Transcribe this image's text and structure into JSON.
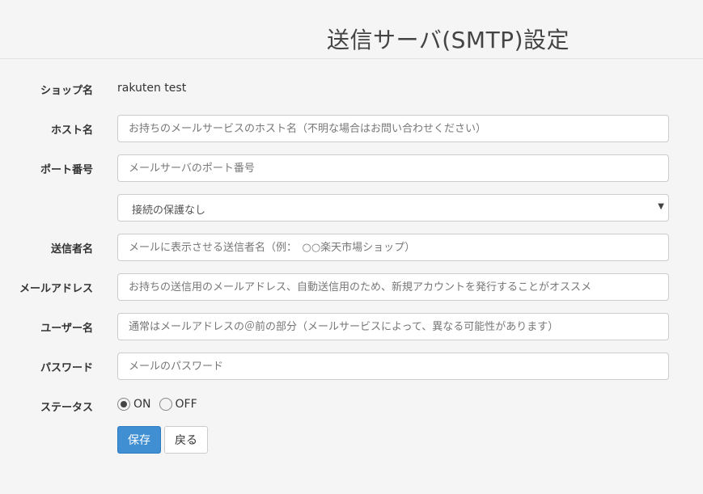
{
  "header": {
    "title": "送信サーバ(SMTP)設定"
  },
  "form": {
    "shop_name": {
      "label": "ショップ名",
      "value": "rakuten test"
    },
    "host": {
      "label": "ホスト名",
      "value": "",
      "placeholder": "お持ちのメールサービスのホスト名（不明な場合はお問い合わせください）"
    },
    "port": {
      "label": "ポート番号",
      "value": "",
      "placeholder": "メールサーバのポート番号"
    },
    "security": {
      "selected": "接続の保護なし"
    },
    "sender_name": {
      "label": "送信者名",
      "value": "",
      "placeholder": "メールに表示させる送信者名（例：　○○楽天市場ショップ）"
    },
    "email": {
      "label": "メールアドレス",
      "value": "",
      "placeholder": "お持ちの送信用のメールアドレス、自動送信用のため、新規アカウントを発行することがオススメ"
    },
    "username": {
      "label": "ユーザー名",
      "value": "",
      "placeholder": "通常はメールアドレスの＠前の部分（メールサービスによって、異なる可能性があります）"
    },
    "password": {
      "label": "パスワード",
      "value": "",
      "placeholder": "メールのパスワード"
    },
    "status": {
      "label": "ステータス",
      "on_label": "ON",
      "off_label": "OFF",
      "selected": "ON"
    }
  },
  "buttons": {
    "save": "保存",
    "back": "戻る"
  },
  "colors": {
    "primary": "#3f8fd2",
    "background": "#f5f5f5"
  }
}
